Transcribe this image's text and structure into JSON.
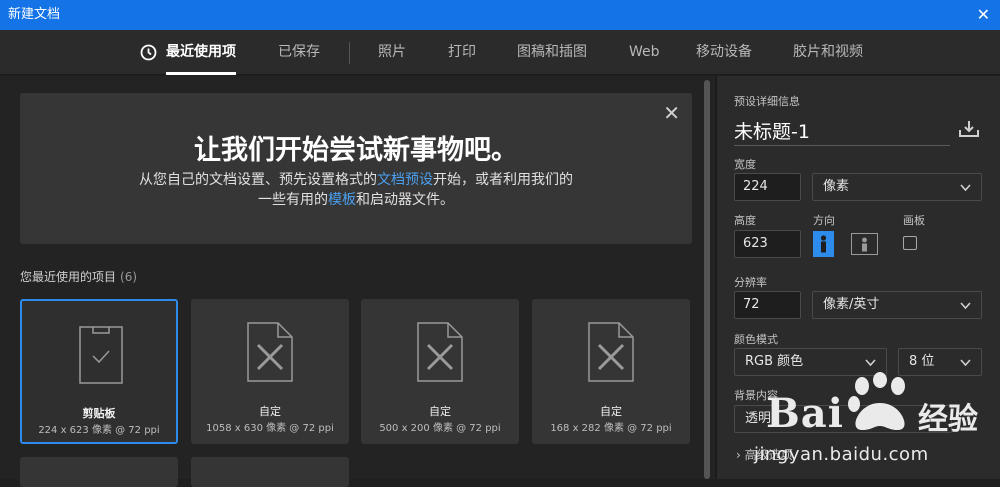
{
  "window": {
    "title": "新建文档",
    "close_glyph": "✕"
  },
  "tabs": [
    {
      "label": "最近使用项",
      "icon": "clock-icon",
      "active": true
    },
    {
      "label": "已保存"
    },
    {
      "label": "照片"
    },
    {
      "label": "打印"
    },
    {
      "label": "图稿和插图"
    },
    {
      "label": "Web"
    },
    {
      "label": "移动设备"
    },
    {
      "label": "胶片和视频"
    }
  ],
  "welcome": {
    "heading": "让我们开始尝试新事物吧。",
    "line1_before": "从您自己的文档设置、预先设置格式的",
    "line1_link": "文档预设",
    "line1_after": "开始，或者利用我们的",
    "line2_before": "一些有用的",
    "line2_link": "模板",
    "line2_after": "和启动器文件。",
    "close_glyph": "✕"
  },
  "recent": {
    "label": "您最近使用的项目",
    "count": "(6)",
    "items": [
      {
        "name": "剪贴板",
        "meta": "224 x 623 像素 @ 72 ppi",
        "icon": "clipboard-icon",
        "selected": true
      },
      {
        "name": "自定",
        "meta": "1058 x 630 像素 @ 72 ppi",
        "icon": "document-icon"
      },
      {
        "name": "自定",
        "meta": "500 x 200 像素 @ 72 ppi",
        "icon": "document-icon"
      },
      {
        "name": "自定",
        "meta": "168 x 282 像素 @ 72 ppi",
        "icon": "document-icon"
      }
    ]
  },
  "preset": {
    "section_label": "预设详细信息",
    "doc_name": "未标题-1",
    "save_icon": "save-preset-icon",
    "width_label": "宽度",
    "width_value": "224",
    "width_unit": "像素",
    "height_label": "高度",
    "height_value": "623",
    "orientation_label": "方向",
    "artboard_label": "画板",
    "resolution_label": "分辨率",
    "resolution_value": "72",
    "resolution_unit": "像素/英寸",
    "color_mode_label": "颜色模式",
    "color_mode": "RGB 颜色",
    "bit_depth": "8 位",
    "background_label": "背景内容",
    "background_value": "透明",
    "advanced_label": "高级选项"
  },
  "watermark": {
    "brand_latin": "Bai",
    "brand_cn": "经验",
    "url": "jingyan.baidu.com"
  },
  "colors": {
    "accent": "#1473e6",
    "link": "#4aa0f0",
    "selection": "#2d8ceb"
  }
}
